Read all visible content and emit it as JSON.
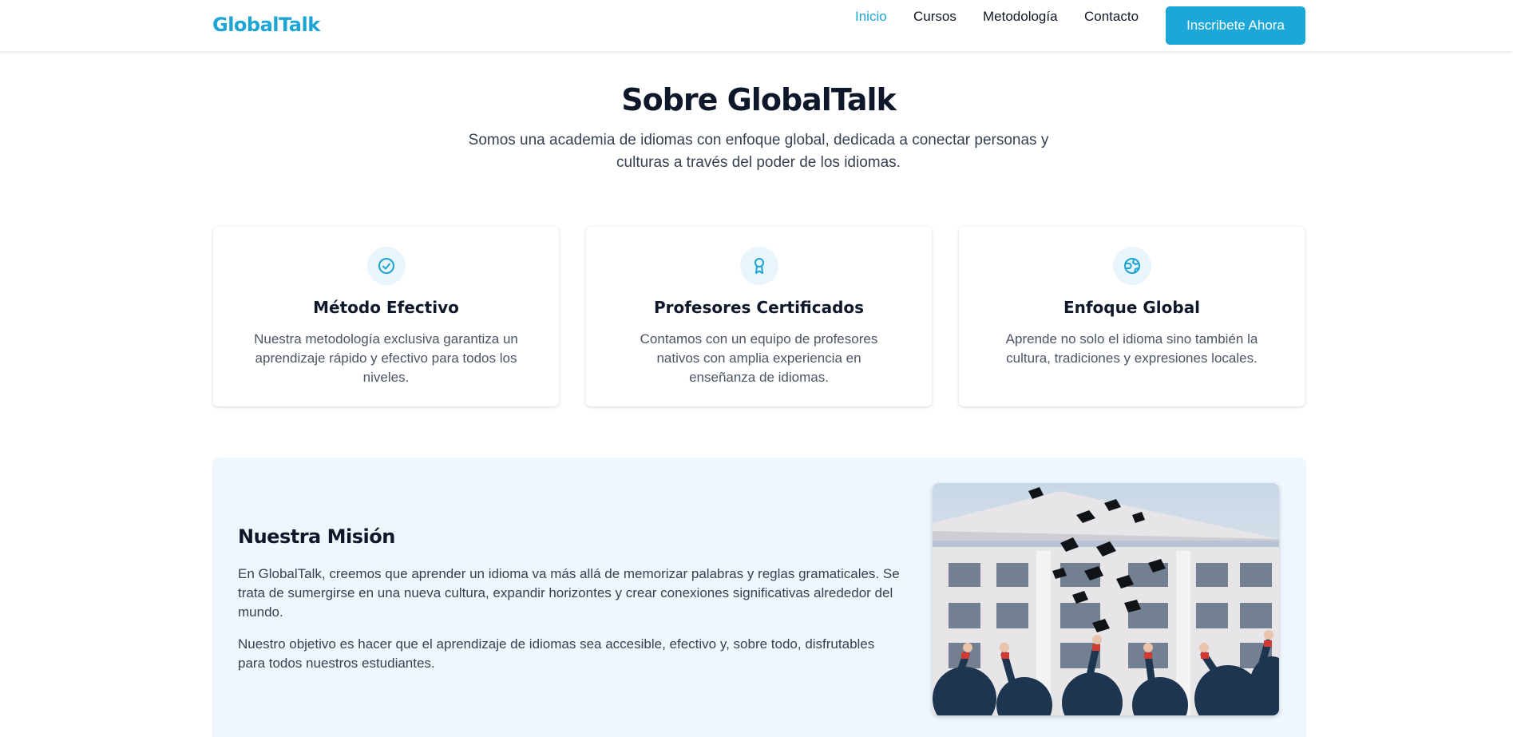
{
  "header": {
    "logo": "GlobalTalk",
    "nav": [
      {
        "label": "Inicio",
        "active": true
      },
      {
        "label": "Cursos",
        "active": false
      },
      {
        "label": "Metodología",
        "active": false
      },
      {
        "label": "Contacto",
        "active": false
      }
    ],
    "cta_label": "Inscribete Ahora"
  },
  "about": {
    "title": "Sobre GlobalTalk",
    "subtitle": "Somos una academia de idiomas con enfoque global, dedicada a conectar personas y culturas a través del poder de los idiomas."
  },
  "features": [
    {
      "icon": "check-circle-icon",
      "title": "Método Efectivo",
      "text": "Nuestra metodología exclusiva garantiza un aprendizaje rápido y efectivo para todos los niveles."
    },
    {
      "icon": "award-icon",
      "title": "Profesores Certificados",
      "text": "Contamos con un equipo de profesores nativos con amplia experiencia en enseñanza de idiomas."
    },
    {
      "icon": "globe-icon",
      "title": "Enfoque Global",
      "text": "Aprende no solo el idioma sino también la cultura, tradiciones y expresiones locales."
    }
  ],
  "mission": {
    "title": "Nuestra Misión",
    "paragraph1": "En GlobalTalk, creemos que aprender un idioma va más allá de memorizar palabras y reglas gramaticales. Se trata de sumergirse en una nueva cultura, expandir horizontes y crear conexiones significativas alrededor del mundo.",
    "paragraph2": "Nuestro objetivo es hacer que el aprendizaje de idiomas sea accesible, efectivo y, sobre todo, disfrutables para todos nuestros estudiantes."
  },
  "colors": {
    "accent": "#1ba4d4",
    "button": "#1ba8d9",
    "heading": "#0f172a",
    "mission_bg": "#eff6fe"
  }
}
